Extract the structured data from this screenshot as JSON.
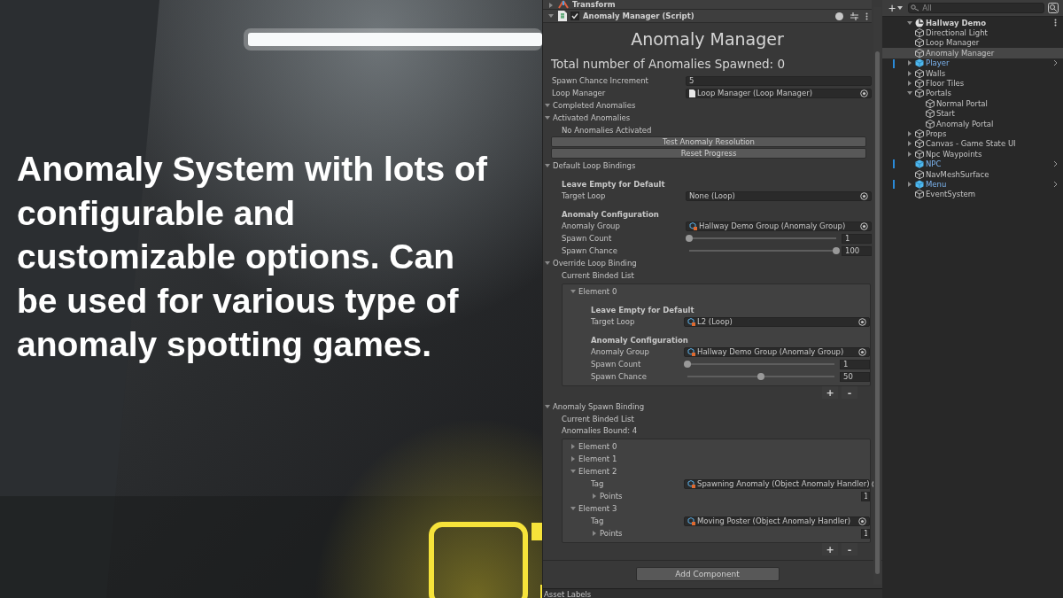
{
  "headline": "Anomaly System with lots of configurable and customizable options. Can be used for various type of anomaly spotting games.",
  "inspector": {
    "collapsed_component": {
      "title": "Transform",
      "expanded": false
    },
    "component": {
      "title": "Anomaly Manager (Script)",
      "expanded": true,
      "enabled": true
    },
    "heading": "Anomaly Manager",
    "total": "Total number of Anomalies Spawned: 0",
    "rows": [
      {
        "kind": "field",
        "label": "Spawn Chance Increment",
        "value": "5"
      },
      {
        "kind": "script_ref",
        "label": "Loop Manager",
        "value": "Loop Manager (Loop Manager)"
      },
      {
        "kind": "foldout",
        "label": "Completed Anomalies",
        "expanded": true
      },
      {
        "kind": "foldout",
        "label": "Activated Anomalies",
        "expanded": true,
        "children": [
          {
            "kind": "text",
            "label": "No Anomalies Activated"
          }
        ]
      },
      {
        "kind": "button",
        "label": "Test Anomaly Resolution"
      },
      {
        "kind": "button",
        "label": "Reset Progress"
      },
      {
        "kind": "foldout",
        "label": "Default Loop Bindings",
        "expanded": true,
        "children": [
          {
            "kind": "subheading",
            "label": "Leave Empty for Default"
          },
          {
            "kind": "empty_ref",
            "label": "Target Loop",
            "value": "None (Loop)"
          },
          {
            "kind": "subheading",
            "label": "Anomaly Configuration"
          },
          {
            "kind": "asset_ref",
            "label": "Anomaly Group",
            "value": "Hallway Demo Group (Anomaly Group)"
          },
          {
            "kind": "slider",
            "label": "Spawn Count",
            "level": 0,
            "value": "1"
          },
          {
            "kind": "slider",
            "label": "Spawn Chance",
            "level": 1,
            "value": "100"
          }
        ]
      },
      {
        "kind": "foldout",
        "label": "Override Loop Binding",
        "expanded": true,
        "children": [
          {
            "kind": "text",
            "label": "Current Binded List"
          },
          {
            "kind": "list",
            "items": [
              {
                "kind": "element",
                "label": "Element 0",
                "expanded": true,
                "children": [
                  {
                    "kind": "subheading",
                    "label": "Leave Empty for Default"
                  },
                  {
                    "kind": "asset_ref",
                    "label": "Target Loop",
                    "value": "L2 (Loop)"
                  },
                  {
                    "kind": "subheading",
                    "label": "Anomaly Configuration"
                  },
                  {
                    "kind": "asset_ref",
                    "label": "Anomaly Group",
                    "value": "Hallway Demo Group (Anomaly Group)"
                  },
                  {
                    "kind": "slider",
                    "label": "Spawn Count",
                    "level": 0,
                    "value": "1"
                  },
                  {
                    "kind": "slider",
                    "label": "Spawn Chance",
                    "level": 0.5,
                    "value": "50"
                  }
                ]
              }
            ],
            "add": "+",
            "remove": "-"
          }
        ]
      },
      {
        "kind": "foldout",
        "label": "Anomaly Spawn Binding",
        "expanded": true,
        "children": [
          {
            "kind": "text",
            "label": "Current Binded List"
          },
          {
            "kind": "text",
            "label": "Anomalies Bound: 4"
          },
          {
            "kind": "list",
            "items": [
              {
                "kind": "element",
                "label": "Element 0",
                "expanded": false
              },
              {
                "kind": "element",
                "label": "Element 1",
                "expanded": false
              },
              {
                "kind": "element",
                "label": "Element 2",
                "expanded": true,
                "children": [
                  {
                    "kind": "asset_ref",
                    "label": "Tag",
                    "value": "Spawning Anomaly (Object Anomaly Handler)"
                  },
                  {
                    "kind": "array",
                    "label": "Points",
                    "expanded": false,
                    "count": "1"
                  }
                ]
              },
              {
                "kind": "element",
                "label": "Element 3",
                "expanded": true,
                "children": [
                  {
                    "kind": "asset_ref",
                    "label": "Tag",
                    "value": "Moving Poster (Object Anomaly Handler)"
                  },
                  {
                    "kind": "array",
                    "label": "Points",
                    "expanded": false,
                    "count": "1"
                  }
                ]
              }
            ],
            "add": "+",
            "remove": "-"
          }
        ]
      }
    ],
    "add_component": "Add Component",
    "footer": "Asset Labels"
  },
  "hierarchy": {
    "add": "+",
    "search": {
      "placeholder": "All"
    },
    "scene": {
      "label": "Hallway Demo",
      "expanded": true,
      "children": [
        {
          "label": "Directional Light",
          "kind": "object",
          "selected": false
        },
        {
          "label": "Loop Manager",
          "kind": "object",
          "selected": false
        },
        {
          "label": "Anomaly Manager",
          "kind": "object",
          "selected": true
        },
        {
          "label": "Player",
          "kind": "prefab",
          "selected": false,
          "expanded": false
        },
        {
          "label": "Walls",
          "kind": "object",
          "selected": false,
          "expanded": false
        },
        {
          "label": "Floor Tiles",
          "kind": "object",
          "selected": false,
          "expanded": false
        },
        {
          "label": "Portals",
          "kind": "object",
          "selected": false,
          "expanded": true,
          "children": [
            {
              "label": "Normal Portal",
              "kind": "object",
              "selected": false
            },
            {
              "label": "Start",
              "kind": "object",
              "selected": false
            },
            {
              "label": "Anomaly Portal",
              "kind": "object",
              "selected": false
            }
          ]
        },
        {
          "label": "Props",
          "kind": "object",
          "selected": false,
          "expanded": false
        },
        {
          "label": "Canvas - Game State UI",
          "kind": "object",
          "selected": false,
          "expanded": false
        },
        {
          "label": "Npc Waypoints",
          "kind": "object",
          "selected": false,
          "expanded": false
        },
        {
          "label": "NPC",
          "kind": "prefab",
          "selected": false
        },
        {
          "label": "NavMeshSurface",
          "kind": "object",
          "selected": false
        },
        {
          "label": "Menu",
          "kind": "prefab",
          "selected": false,
          "expanded": false
        },
        {
          "label": "EventSystem",
          "kind": "object",
          "selected": false
        }
      ]
    }
  }
}
